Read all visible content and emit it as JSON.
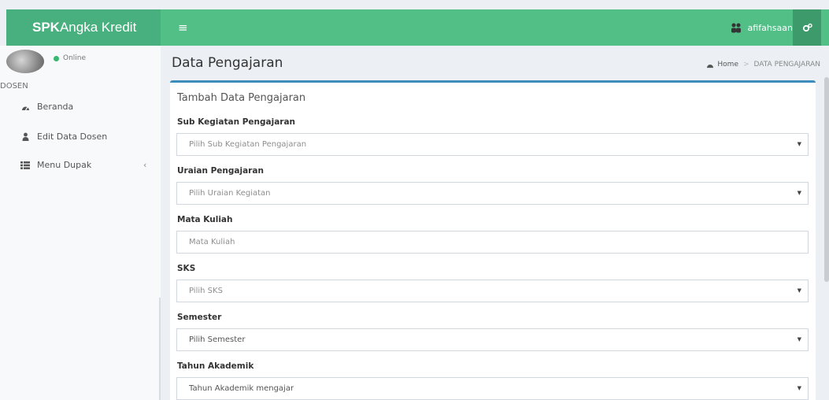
{
  "app": {
    "brand_bold": "SPK",
    "brand_rest": "Angka Kredit",
    "toggle_icon": "≡"
  },
  "user": {
    "name": "afifahsaan",
    "status": "Online"
  },
  "sidebar": {
    "section": "DOSEN",
    "items": [
      {
        "label": "Beranda",
        "icon": "dashboard-icon"
      },
      {
        "label": "Edit Data Dosen",
        "icon": "user-icon"
      },
      {
        "label": "Menu Dupak",
        "icon": "grid-icon"
      }
    ],
    "chevron": "‹"
  },
  "page": {
    "title": "Data Pengajaran",
    "breadcrumb": {
      "home": "Home",
      "current": "DATA PENGAJARAN"
    }
  },
  "form": {
    "title": "Tambah Data Pengajaran",
    "fields": [
      {
        "label": "Sub Kegiatan Pengajaran",
        "value": "Pilih Sub Kegiatan Pengajaran",
        "type": "select"
      },
      {
        "label": "Uraian Pengajaran",
        "value": "Pilih Uraian Kegiatan",
        "type": "select"
      },
      {
        "label": "Mata Kuliah",
        "placeholder": "Mata Kuliah",
        "type": "text"
      },
      {
        "label": "SKS",
        "value": "Pilih SKS",
        "type": "select"
      },
      {
        "label": "Semester",
        "value": "Pilih Semester",
        "type": "select"
      },
      {
        "label": "Tahun Akademik",
        "value": "Tahun Akademik mengajar",
        "type": "select"
      }
    ]
  },
  "colors": {
    "header": "#51bf86",
    "logo": "#48b07e",
    "box_border": "#3c8dbc"
  }
}
